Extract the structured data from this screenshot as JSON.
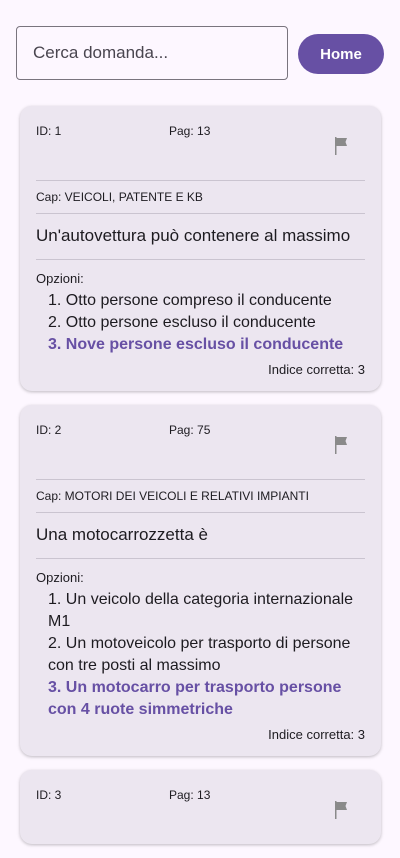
{
  "search": {
    "placeholder": "Cerca domanda..."
  },
  "home_label": "Home",
  "colors": {
    "accent": "#6750a4",
    "card": "#ece6f0",
    "background": "#fdf7ff"
  },
  "questions": [
    {
      "id_label": "ID: 1",
      "page_label": "Pag: 13",
      "chapter_label": "Cap: VEICOLI, PATENTE E KB",
      "question": "Un'autovettura può contenere al massimo",
      "options_title": "Opzioni:",
      "options": [
        "1. Otto persone compreso il conducente",
        "2. Otto persone escluso il conducente",
        "3. Nove persone escluso il conducente"
      ],
      "correct_option": 3,
      "correct_label": "Indice corretta: 3",
      "flag_icon": "flag-icon"
    },
    {
      "id_label": "ID: 2",
      "page_label": "Pag: 75",
      "chapter_label": "Cap: MOTORI DEI VEICOLI E RELATIVI IMPIANTI",
      "question": "Una motocarrozzetta è",
      "options_title": "Opzioni:",
      "options": [
        "1. Un veicolo della categoria internazionale M1",
        "2. Un motoveicolo per trasporto di persone con tre posti al massimo",
        "3. Un motocarro per trasporto persone con 4 ruote simmetriche"
      ],
      "correct_option": 3,
      "correct_label": "Indice corretta: 3",
      "flag_icon": "flag-icon"
    },
    {
      "id_label": "ID: 3",
      "page_label": "Pag: 13",
      "flag_icon": "flag-icon"
    }
  ]
}
